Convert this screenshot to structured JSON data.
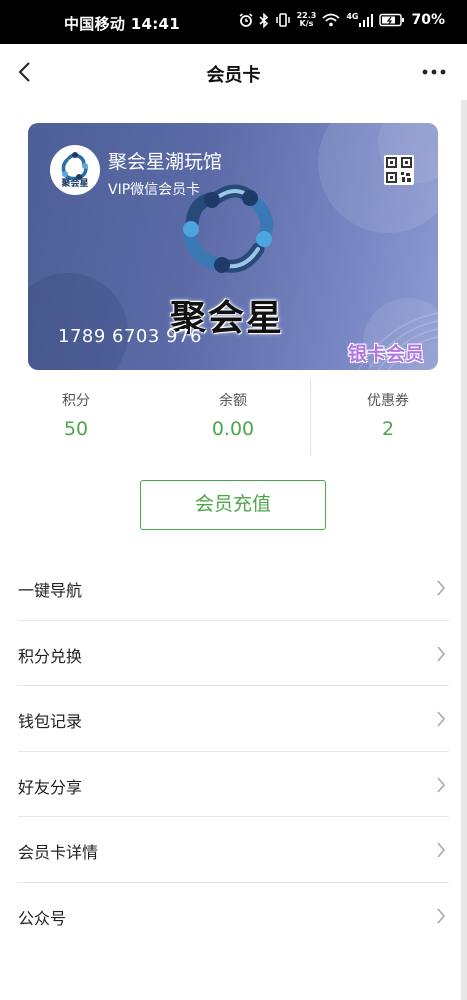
{
  "status_bar": {
    "carrier_time": "中国移动 14:41",
    "network_speed_top": "22.3",
    "network_speed_bottom": "K/s",
    "signal_badge": "4G",
    "battery_percent": "70%"
  },
  "nav": {
    "title": "会员卡",
    "back_icon": "chevron-left-icon",
    "more_icon": "more-dots-icon"
  },
  "card": {
    "store_name": "聚会星潮玩馆",
    "card_type": "VIP微信会员卡",
    "badge_text": "聚会星",
    "brand_mark": "聚会星",
    "card_number": "1789 6703 976",
    "level": "银卡会员",
    "colors": {
      "gradient_start": "#4c5f96",
      "gradient_end": "#8d9ad2",
      "level_text": "#b076e6"
    }
  },
  "stats": [
    {
      "label": "积分",
      "value": "50"
    },
    {
      "label": "余额",
      "value": "0.00"
    },
    {
      "label": "优惠券",
      "value": "2"
    }
  ],
  "recharge_button": {
    "label": "会员充值",
    "color": "#4ca64c"
  },
  "menu": [
    {
      "label": "一键导航"
    },
    {
      "label": "积分兑换"
    },
    {
      "label": "钱包记录"
    },
    {
      "label": "好友分享"
    },
    {
      "label": "会员卡详情"
    },
    {
      "label": "公众号"
    }
  ]
}
